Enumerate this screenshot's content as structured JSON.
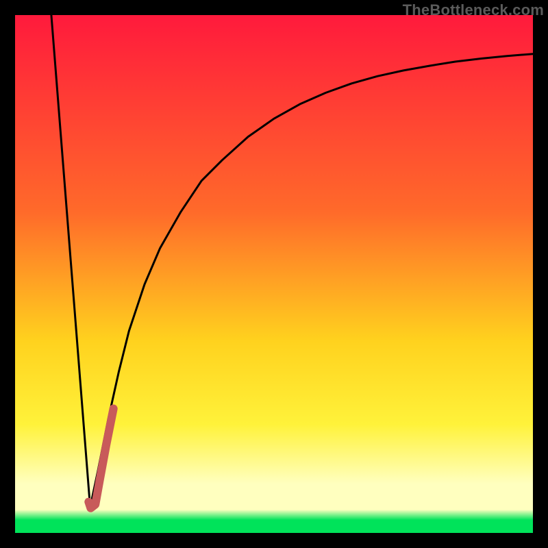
{
  "watermark": {
    "text": "TheBottleneck.com"
  },
  "colors": {
    "frame": "#000000",
    "watermark": "#5b5b5b",
    "gradient_top": "#ff1a3c",
    "gradient_mid1": "#ff6a2a",
    "gradient_mid2": "#ffd21e",
    "gradient_yellow": "#fff23a",
    "gradient_pale": "#ffffbf",
    "gradient_green": "#00e35a",
    "curve": "#000000",
    "marker": "#c85a5a"
  },
  "chart_data": {
    "type": "line",
    "title": "",
    "xlabel": "",
    "ylabel": "",
    "xlim": [
      0,
      100
    ],
    "ylim": [
      0,
      100
    ],
    "grid": false,
    "legend": false,
    "series": [
      {
        "name": "left-segment",
        "x": [
          7,
          14.5
        ],
        "y": [
          100,
          5
        ]
      },
      {
        "name": "right-curve",
        "x": [
          14.5,
          16,
          18,
          20,
          22,
          25,
          28,
          32,
          36,
          40,
          45,
          50,
          55,
          60,
          65,
          70,
          75,
          80,
          85,
          90,
          95,
          100
        ],
        "y": [
          5,
          12,
          22,
          31,
          39,
          48,
          55,
          62,
          68,
          72,
          76.5,
          80,
          82.8,
          85,
          86.8,
          88.2,
          89.3,
          90.2,
          91,
          91.6,
          92.1,
          92.5
        ]
      }
    ],
    "marker": {
      "name": "highlight-j",
      "stroke_width_pct": 1.6,
      "points_xy": [
        [
          14.2,
          6.0
        ],
        [
          14.6,
          4.8
        ],
        [
          15.5,
          5.5
        ],
        [
          16.4,
          10.5
        ],
        [
          17.6,
          17.0
        ],
        [
          19.0,
          24.0
        ]
      ]
    },
    "background_gradient_stops": [
      {
        "pct": 0,
        "note": "top red"
      },
      {
        "pct": 38,
        "note": "orange"
      },
      {
        "pct": 63,
        "note": "yellow"
      },
      {
        "pct": 79,
        "note": "bright yellow"
      },
      {
        "pct": 90.5,
        "note": "pale yellow band top"
      },
      {
        "pct": 95.5,
        "note": "pale yellow band bottom"
      },
      {
        "pct": 97.5,
        "note": "green band top"
      },
      {
        "pct": 100,
        "note": "green bottom"
      }
    ]
  }
}
